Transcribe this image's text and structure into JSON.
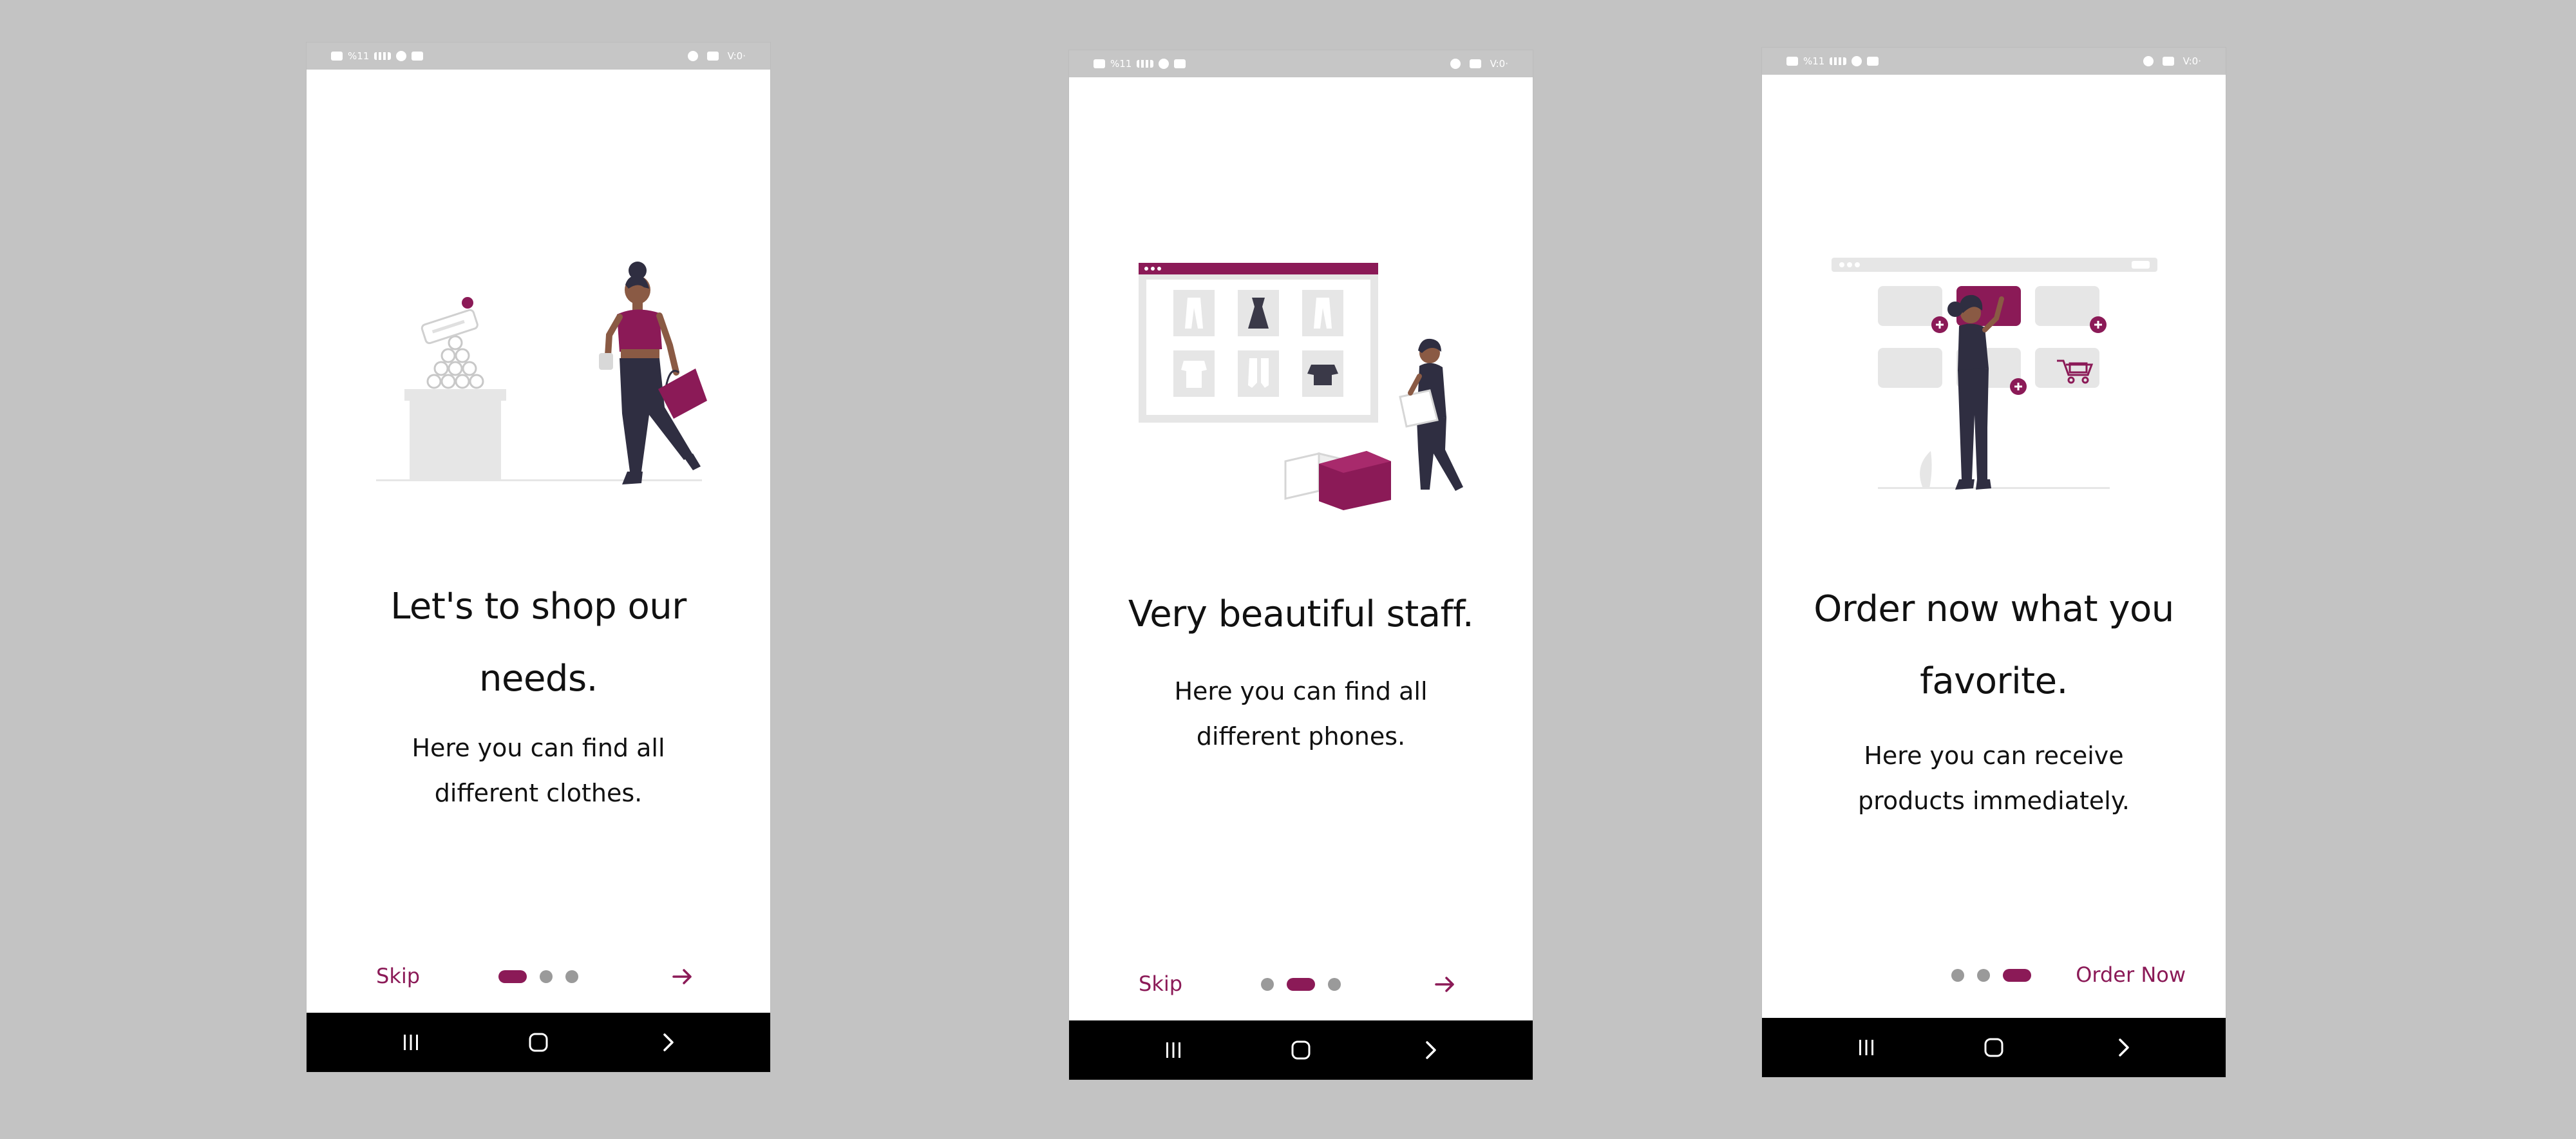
{
  "colors": {
    "background": "#c3c3c3",
    "accent": "#8b1a57",
    "text": "#111111",
    "status_bar": "#c6c6c6",
    "nav_bar": "#000000",
    "dot_inactive": "#9a9a9a",
    "illustration_gray": "#e6e6e6",
    "illustration_dark": "#2f2e41"
  },
  "status_bar": {
    "left_text": "%11",
    "right_text": "V:0·"
  },
  "nav_icons": [
    "recent-apps-icon",
    "home-icon",
    "back-icon"
  ],
  "screens": [
    {
      "title": "Let's to shop our needs.",
      "subtitle": "Here you can find all different clothes.",
      "skip_label": "Skip",
      "active_page": 0,
      "page_count": 3,
      "illustration": "woman-shopping-with-bag-illustration",
      "next_icon": "arrow-right-icon"
    },
    {
      "title": "Very beautiful staff.",
      "subtitle": "Here you can find all different phones.",
      "skip_label": "Skip",
      "active_page": 1,
      "page_count": 3,
      "illustration": "online-store-delivery-boxes-illustration",
      "next_icon": "arrow-right-icon"
    },
    {
      "title": "Order now what you favorite.",
      "subtitle": "Here you can receive products immediately.",
      "action_label": "Order Now",
      "active_page": 2,
      "page_count": 3,
      "illustration": "woman-selecting-products-illustration"
    }
  ]
}
